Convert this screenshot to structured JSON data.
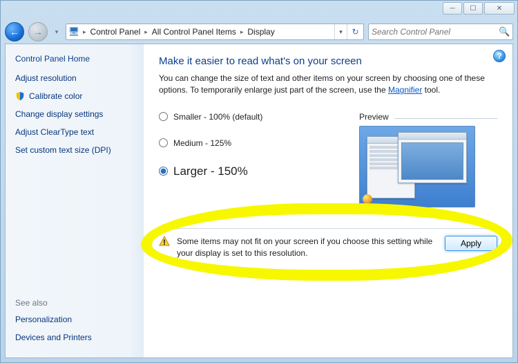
{
  "titlebar": {
    "minimize": "─",
    "maximize": "☐",
    "close": "✕"
  },
  "nav": {
    "back_glyph": "←",
    "fwd_glyph": "→",
    "history_glyph": "▾",
    "dropdown_glyph": "▾",
    "refresh_glyph": "↻"
  },
  "breadcrumb": {
    "seg1": "Control Panel",
    "seg2": "All Control Panel Items",
    "seg3": "Display",
    "sep": "▸"
  },
  "search": {
    "placeholder": "Search Control Panel",
    "icon": "🔍"
  },
  "sidebar": {
    "home": "Control Panel Home",
    "links": [
      "Adjust resolution",
      "Calibrate color",
      "Change display settings",
      "Adjust ClearType text",
      "Set custom text size (DPI)"
    ],
    "seealso_label": "See also",
    "seealso": [
      "Personalization",
      "Devices and Printers"
    ]
  },
  "main": {
    "heading": "Make it easier to read what's on your screen",
    "desc_before": "You can change the size of text and other items on your screen by choosing one of these options. To temporarily enlarge just part of the screen, use the ",
    "desc_link": "Magnifier",
    "desc_after": " tool.",
    "preview_label": "Preview",
    "options": {
      "small": "Smaller - 100% (default)",
      "medium": "Medium - 125%",
      "large": "Larger - 150%"
    },
    "warning": "Some items may not fit on your screen if you choose this setting while your display is set to this resolution.",
    "apply": "Apply",
    "help": "?"
  }
}
